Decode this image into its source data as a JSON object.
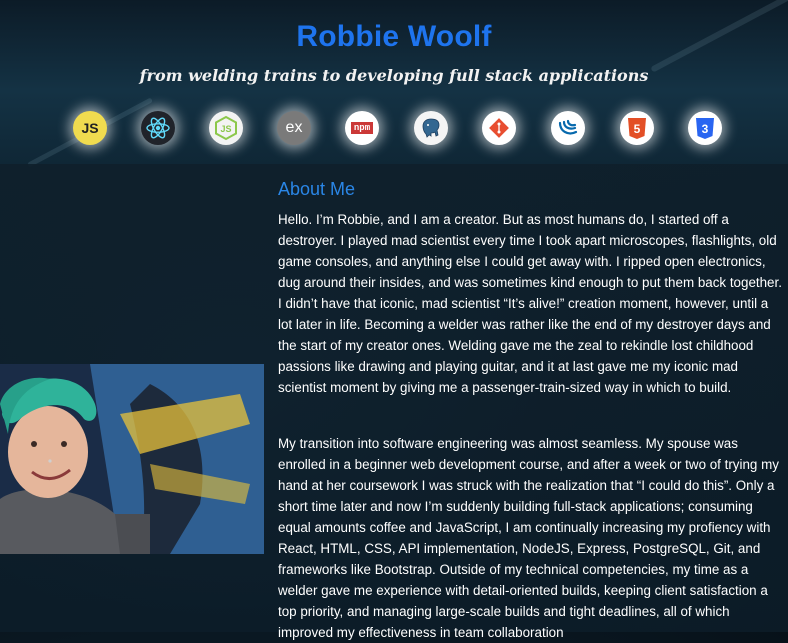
{
  "header": {
    "title": "Robbie Woolf",
    "tagline": "from welding trains to developing full stack applications"
  },
  "tech_icons": [
    {
      "name": "javascript-icon",
      "text": "JS",
      "color": "#f0db4f"
    },
    {
      "name": "react-icon",
      "text": "",
      "color": "#61dafb"
    },
    {
      "name": "nodejs-icon",
      "text": "JS",
      "color": "#8cc84b"
    },
    {
      "name": "express-icon",
      "text": "ex",
      "color": "#7a7a7a"
    },
    {
      "name": "npm-icon",
      "text": "npm",
      "color": "#cb3837"
    },
    {
      "name": "postgresql-icon",
      "text": "",
      "color": "#336791"
    },
    {
      "name": "git-icon",
      "text": "",
      "color": "#e84e31"
    },
    {
      "name": "jquery-icon",
      "text": "",
      "color": "#0769ad"
    },
    {
      "name": "html5-icon",
      "text": "5",
      "color": "#e34f26"
    },
    {
      "name": "css3-icon",
      "text": "3",
      "color": "#2965f1"
    }
  ],
  "about": {
    "title": "About Me",
    "p1": "Hello. I’m Robbie, and I am a creator. But as most humans do, I started off a destroyer. I played mad scientist every time I took apart microscopes, flashlights, old game consoles, and anything else I could get away with. I ripped open electronics, dug around their insides, and was sometimes kind enough to put them back together. I didn’t have that iconic, mad scientist “It’s alive!” creation moment, however, until a lot later in life. Becoming a welder was rather like the end of my destroyer days and the start of my creator ones. Welding gave me the zeal to rekindle lost childhood passions like drawing and playing guitar, and it at last gave me my iconic mad scientist moment by giving me a passenger-train-sized way in which to build.",
    "p2": "My transition into software engineering was almost seamless. My spouse was enrolled in a beginner web development course, and after a week or two of trying my hand at her coursework I was struck with the realization that “I could do this”. Only a short time later and now I’m suddenly building full-stack applications; consuming equal amounts coffee and JavaScript, I am continually increasing my profiency with React, HTML, CSS, API implementation, NodeJS, Express, PostgreSQL, Git, and frameworks like Bootstrap. Outside of my technical competencies, my time as a welder gave me experience with detail-oriented builds, keeping client satisfaction a top priority, and managing large-scale builds and tight deadlines, all of which improved my effectiveness in team collaboration"
  }
}
